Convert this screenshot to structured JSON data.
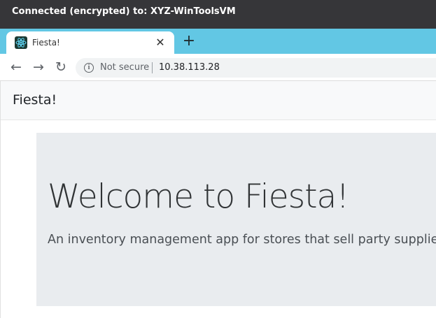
{
  "session": {
    "status": "Connected (encrypted) to: XYZ-WinToolsVM"
  },
  "browser": {
    "tab": {
      "title": "Fiesta!",
      "favicon": "react-atom-icon",
      "close_symbol": "✕"
    },
    "new_tab_symbol": "+",
    "nav": {
      "back": "←",
      "forward": "→",
      "reload": "↻"
    },
    "address_bar": {
      "info_symbol": "i",
      "security": "Not secure",
      "url": "10.38.113.28"
    }
  },
  "page": {
    "brand": "Fiesta!",
    "hero": {
      "title": "Welcome to Fiesta!",
      "subtitle": "An inventory management app for stores that sell party supplies."
    }
  },
  "colors": {
    "session_bar": "#363639",
    "tab_strip": "#62c7e4",
    "navbar": "#f8f9fa",
    "jumbotron": "#e9ecef"
  }
}
